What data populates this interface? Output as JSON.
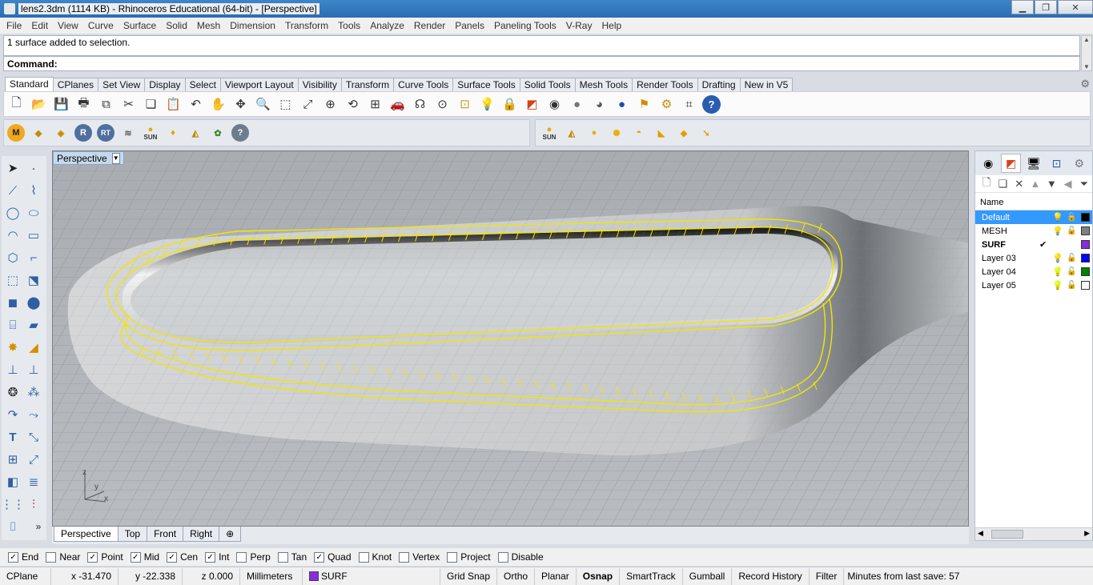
{
  "window": {
    "title": "lens2.3dm (1114 KB) - Rhinoceros Educational (64-bit) - [Perspective]"
  },
  "menu": [
    "File",
    "Edit",
    "View",
    "Curve",
    "Surface",
    "Solid",
    "Mesh",
    "Dimension",
    "Transform",
    "Tools",
    "Analyze",
    "Render",
    "Panels",
    "Paneling Tools",
    "V-Ray",
    "Help"
  ],
  "command": {
    "history": "1 surface added to selection.",
    "prompt": "Command:"
  },
  "tool_tabs": [
    "Standard",
    "CPlanes",
    "Set View",
    "Display",
    "Select",
    "Viewport Layout",
    "Visibility",
    "Transform",
    "Curve Tools",
    "Surface Tools",
    "Solid Tools",
    "Mesh Tools",
    "Render Tools",
    "Drafting",
    "New in V5"
  ],
  "standard_toolbar_icons": [
    "new-file-icon",
    "open-icon",
    "save-icon",
    "print-icon",
    "import-icon",
    "cut-icon",
    "copy-icon",
    "paste-icon",
    "undo-icon",
    "pan-icon",
    "rotate-view-icon",
    "zoom-icon",
    "zoom-window-icon",
    "zoom-extents-icon",
    "zoom-selected-icon",
    "four-viewports-icon",
    "car-icon",
    "render-preview-icon",
    "osnap-icon",
    "cplane-icon",
    "bulb-icon",
    "lock-icon",
    "layer-icon",
    "color-wheel-icon",
    "shaded-sphere-icon",
    "rendered-sphere-icon",
    "material-sphere-icon",
    "flag-icon",
    "gear-icon",
    "history-icon",
    "help-icon"
  ],
  "vray_toolbar": {
    "buttons": [
      "M",
      "",
      "",
      "R",
      "RT",
      "",
      "SUN",
      "",
      "",
      "?"
    ],
    "sun_label": "SUN"
  },
  "lights_toolbar": {
    "sun_label": "SUN"
  },
  "viewport": {
    "name": "Perspective",
    "axis": {
      "z": "z",
      "y": "y",
      "x": "x"
    }
  },
  "viewport_tabs": [
    "Perspective",
    "Top",
    "Front",
    "Right"
  ],
  "layers_panel": {
    "header": "Name",
    "layers": [
      {
        "name": "Default",
        "current": "",
        "color": "#000000",
        "bulb": "on",
        "selected": true
      },
      {
        "name": "MESH",
        "current": "",
        "color": "#808080",
        "bulb": "on",
        "selected": false
      },
      {
        "name": "SURF",
        "current": "✔",
        "color": "#8a2be2",
        "bulb": "",
        "selected": false
      },
      {
        "name": "Layer 03",
        "current": "",
        "color": "#0000ff",
        "bulb": "on",
        "selected": false
      },
      {
        "name": "Layer 04",
        "current": "",
        "color": "#008000",
        "bulb": "off",
        "selected": false
      },
      {
        "name": "Layer 05",
        "current": "",
        "color": "#ffffff",
        "bulb": "off",
        "selected": false
      }
    ]
  },
  "osnaps": [
    {
      "label": "End",
      "checked": true
    },
    {
      "label": "Near",
      "checked": false
    },
    {
      "label": "Point",
      "checked": true
    },
    {
      "label": "Mid",
      "checked": true
    },
    {
      "label": "Cen",
      "checked": true
    },
    {
      "label": "Int",
      "checked": true
    },
    {
      "label": "Perp",
      "checked": false
    },
    {
      "label": "Tan",
      "checked": false
    },
    {
      "label": "Quad",
      "checked": true
    },
    {
      "label": "Knot",
      "checked": false
    },
    {
      "label": "Vertex",
      "checked": false
    },
    {
      "label": "Project",
      "checked": false
    },
    {
      "label": "Disable",
      "checked": false
    }
  ],
  "status": {
    "cplane": "CPlane",
    "x": "x -31.470",
    "y": "y -22.338",
    "z": "z 0.000",
    "units": "Millimeters",
    "layer": "SURF",
    "layer_color": "#8a2be2",
    "grid_snap": "Grid Snap",
    "ortho": "Ortho",
    "planar": "Planar",
    "osnap": "Osnap",
    "smarttrack": "SmartTrack",
    "gumball": "Gumball",
    "record_history": "Record History",
    "filter": "Filter",
    "save_info": "Minutes from last save: 57"
  }
}
